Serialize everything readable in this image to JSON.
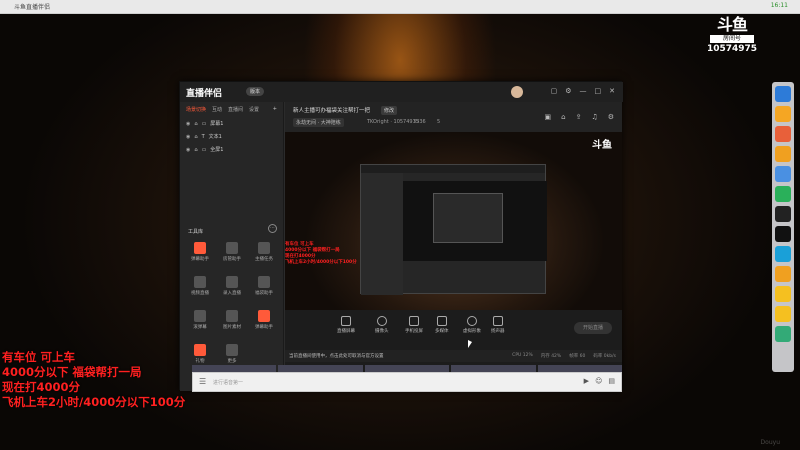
{
  "window": {
    "title": "斗鱼直播伴侣",
    "time": "16:11"
  },
  "room_badge": {
    "glyph": "斗鱼",
    "label": "房间号",
    "number": "10574975"
  },
  "overlay": {
    "lines": [
      "有车位 可上车",
      "4000分以下 福袋帮打一局",
      "现在打4000分",
      "飞机上车2小时/4000分以下100分"
    ],
    "color": "#ff2020"
  },
  "app": {
    "logo": "直播伴侣",
    "version": "版本",
    "sidebar": {
      "tabs": [
        "场景切换",
        "互动",
        "直播间",
        "设置"
      ],
      "scenes": [
        "屏幕1",
        "文本1",
        "全屏1"
      ],
      "tools_label": "工具库",
      "tools": [
        {
          "label": "弹幕助手",
          "accent": true
        },
        {
          "label": "房管助手",
          "accent": false
        },
        {
          "label": "主播任务",
          "accent": false
        },
        {
          "label": "视频直播",
          "accent": false
        },
        {
          "label": "录入直播",
          "accent": false
        },
        {
          "label": "福袋助手",
          "accent": false
        },
        {
          "label": "滚弹幕",
          "accent": false
        },
        {
          "label": "图片素材",
          "accent": false
        },
        {
          "label": "弹幕助手",
          "accent": true
        },
        {
          "label": "礼物",
          "accent": true
        },
        {
          "label": "更多",
          "accent": false
        }
      ]
    },
    "header": {
      "title": "新人主播可办福袋关注帮打一把",
      "edit": "修改",
      "category": "永劫无间 · 大神陪练",
      "room_id": "TKOright · 10574975",
      "fans": "3336",
      "hot": "5"
    },
    "controls": [
      "直播屏幕",
      "摄像头",
      "手机投屏",
      "多媒体",
      "虚拟形象",
      "扬声器"
    ],
    "go_live": "开始直播",
    "status": {
      "warn": "当前直播间使用中，点击此处可取消与官方设置",
      "stats": [
        "CPU 12%",
        "内存 42%",
        "帧率 60",
        "码率 0kb/s"
      ]
    },
    "chat": {
      "placeholder": "进行语音第一"
    }
  },
  "watermark": "Douyu"
}
